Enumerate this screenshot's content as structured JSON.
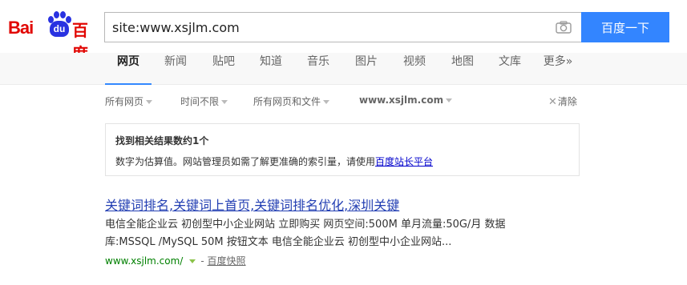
{
  "logo": {
    "latin": "Bai",
    "paw_text": "du",
    "chinese": "百度"
  },
  "search": {
    "query": "site:www.xsjlm.com",
    "button_label": "百度一下"
  },
  "tabs": [
    {
      "label": "网页",
      "active": true
    },
    {
      "label": "新闻"
    },
    {
      "label": "贴吧"
    },
    {
      "label": "知道"
    },
    {
      "label": "音乐"
    },
    {
      "label": "图片"
    },
    {
      "label": "视频"
    },
    {
      "label": "地图"
    },
    {
      "label": "文库"
    },
    {
      "label": "更多»"
    }
  ],
  "filters": {
    "scope": "所有网页",
    "time": "时间不限",
    "filetype": "所有网页和文件",
    "site": "www.xsjlm.com",
    "clear": "清除"
  },
  "info": {
    "title": "找到相关结果数约1个",
    "text": "数字为估算值。网站管理员如需了解更准确的索引量，请使用",
    "link": "百度站长平台"
  },
  "result": {
    "title": "关键词排名,关键词上首页,关键词排名优化,深圳关键",
    "abstract_line1": "电信全能企业云 初创型中小企业网站 立即购买 网页空间:500M 单月流量:50G/月 数据",
    "abstract_line2": "库:MSSQL /MySQL 50M 按钮文本 电信全能企业云 初创型中小企业网站...",
    "url": "www.xsjlm.com/",
    "separator": "-",
    "snapshot": "百度快照"
  },
  "colors": {
    "accent": "#3385ff",
    "brand_red": "#e10602",
    "brand_blue": "#2932e1",
    "link": "#2440b3",
    "url_green": "#008000"
  }
}
